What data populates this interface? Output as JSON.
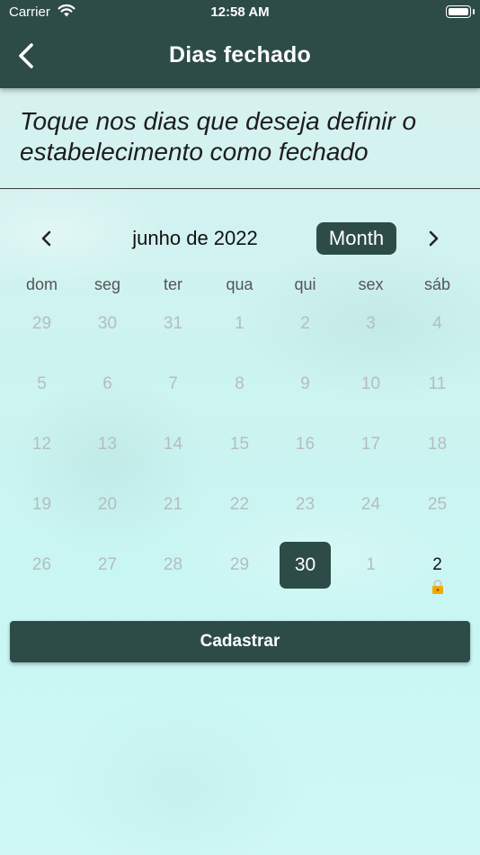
{
  "status_bar": {
    "carrier": "Carrier",
    "time": "12:58 AM"
  },
  "header": {
    "title": "Dias fechado"
  },
  "instruction": "Toque nos dias que deseja definir o estabelecimento como fechado",
  "calendar": {
    "month_label": "junho de 2022",
    "format_button": "Month",
    "weekdays": [
      "dom",
      "seg",
      "ter",
      "qua",
      "qui",
      "sex",
      "sáb"
    ],
    "weeks": [
      [
        "29",
        "30",
        "31",
        "1",
        "2",
        "3",
        "4"
      ],
      [
        "5",
        "6",
        "7",
        "8",
        "9",
        "10",
        "11"
      ],
      [
        "12",
        "13",
        "14",
        "15",
        "16",
        "17",
        "18"
      ],
      [
        "19",
        "20",
        "21",
        "22",
        "23",
        "24",
        "25"
      ],
      [
        "26",
        "27",
        "28",
        "29",
        "30",
        "1",
        "2"
      ]
    ],
    "selected_day": "30",
    "closed_day_marker": "2",
    "colors": {
      "accent": "#2d4c48",
      "muted_day": "#b5bdbd",
      "lock": "#f2a900"
    }
  },
  "submit_button": "Cadastrar"
}
